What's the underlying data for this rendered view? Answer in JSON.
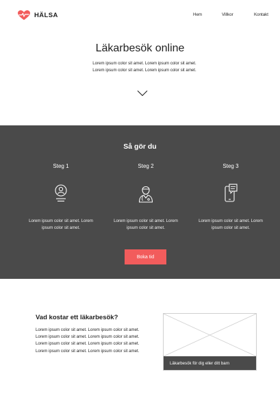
{
  "brand": {
    "name": "HÄLSA",
    "accent_color": "#f25c5c",
    "logo_icon": "heart-pulse-icon"
  },
  "nav": {
    "items": [
      "Hem",
      "Villkor",
      "Kontakt"
    ]
  },
  "hero": {
    "title": "Läkarbesök online",
    "text": "Lorem ipsum color sit amet. Lorem ipsum color sit amet. Lorem ipsum color sit amet. Lorem ipsum color sit amet.",
    "chevron_icon": "chevron-down-icon"
  },
  "steps": {
    "title": "Så gör du",
    "background_color": "#4a4a4a",
    "items": [
      {
        "label": "Steg 1",
        "icon": "user-badge-icon",
        "text": "Lorem ipsum color sit amet. Lorem ipsum color sit amet."
      },
      {
        "label": "Steg 2",
        "icon": "doctor-icon",
        "text": "Lorem ipsum color sit amet. Lorem ipsum color sit amet."
      },
      {
        "label": "Steg 3",
        "icon": "phone-chat-icon",
        "text": "Lorem ipsum color sit amet. Lorem ipsum color sit amet."
      }
    ],
    "button_label": "Boka tid"
  },
  "cost": {
    "title": "Vad kostar ett läkarbesök?",
    "text": "Lorem ipsum color sit amet. Lorem ipsum color sit amet. Lorem ipsum color sit amet. Lorem ipsum color sit amet. Lorem ipsum color sit amet. Lorem ipsum color sit amet. Lorem ipsum color sit amet. Lorem ipsum color sit amet.",
    "image_caption": "Läkarbesök för dig eller ditt barn",
    "image_placeholder_icon": "image-placeholder-icon"
  }
}
